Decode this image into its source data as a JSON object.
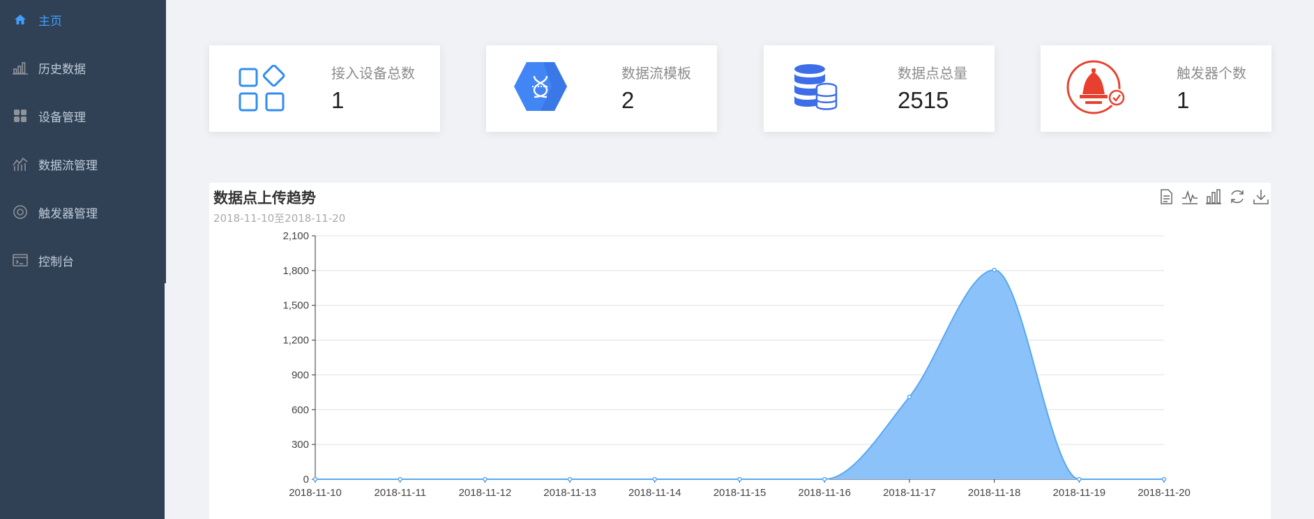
{
  "sidebar": {
    "items": [
      {
        "label": "主页",
        "icon": "home-icon",
        "active": true
      },
      {
        "label": "历史数据",
        "icon": "bar-chart-icon",
        "active": false
      },
      {
        "label": "设备管理",
        "icon": "grid-icon",
        "active": false
      },
      {
        "label": "数据流管理",
        "icon": "line-chart-icon",
        "active": false
      },
      {
        "label": "触发器管理",
        "icon": "target-icon",
        "active": false
      },
      {
        "label": "控制台",
        "icon": "terminal-icon",
        "active": false
      }
    ]
  },
  "cards": [
    {
      "title": "接入设备总数",
      "value": "1",
      "icon": "apps-icon",
      "color": "#2f8cf0"
    },
    {
      "title": "数据流模板",
      "value": "2",
      "icon": "dataflow-hexagon-icon",
      "color": "#4285f4"
    },
    {
      "title": "数据点总量",
      "value": "2515",
      "icon": "database-icon",
      "color": "#3d6ee8"
    },
    {
      "title": "触发器个数",
      "value": "1",
      "icon": "alarm-bell-icon",
      "color": "#e8402f"
    }
  ],
  "chart": {
    "title": "数据点上传趋势",
    "subtitle": "2018-11-10至2018-11-20",
    "toolbox": [
      "data-view-icon",
      "line-switch-icon",
      "bar-switch-icon",
      "restore-icon",
      "save-image-icon"
    ]
  },
  "chart_data": {
    "type": "area",
    "x": [
      "2018-11-10",
      "2018-11-11",
      "2018-11-12",
      "2018-11-13",
      "2018-11-14",
      "2018-11-15",
      "2018-11-16",
      "2018-11-17",
      "2018-11-18",
      "2018-11-19",
      "2018-11-20"
    ],
    "series": [
      {
        "values": [
          0,
          0,
          0,
          0,
          0,
          0,
          0,
          710,
          1805,
          0,
          0
        ]
      }
    ],
    "ylim": [
      0,
      2100
    ],
    "yticks": [
      "0",
      "300",
      "600",
      "900",
      "1,200",
      "1,500",
      "1,800",
      "2,100"
    ],
    "grid": true,
    "smooth": true,
    "line_color": "#5aa8f0",
    "fill_color": "#8cc2fa"
  }
}
